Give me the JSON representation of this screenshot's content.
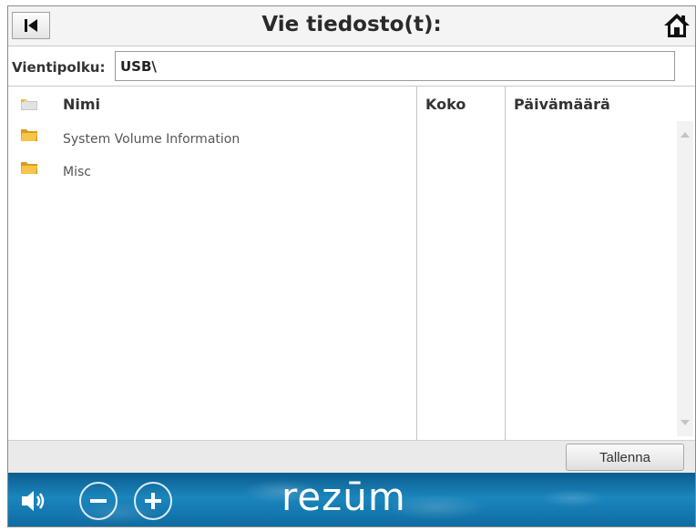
{
  "header": {
    "title": "Vie tiedosto(t):",
    "back_icon": "skip-back-icon",
    "home_icon": "home-icon"
  },
  "path": {
    "label": "Vientipolku:",
    "value": "USB\\"
  },
  "columns": {
    "name": "Nimi",
    "size": "Koko",
    "date": "Päivämäärä"
  },
  "files": [
    {
      "name": "System Volume Information",
      "size": "",
      "date": "",
      "icon": "folder-icon"
    },
    {
      "name": "Misc",
      "size": "",
      "date": "",
      "icon": "folder-icon"
    }
  ],
  "actions": {
    "save_label": "Tallenna"
  },
  "footer": {
    "brand": "rezūm",
    "speaker_icon": "speaker-icon",
    "minus_icon": "minus-icon",
    "plus_icon": "plus-icon"
  },
  "colors": {
    "footer_blue": "#1a86bd",
    "folder_yellow": "#f2b63a"
  }
}
